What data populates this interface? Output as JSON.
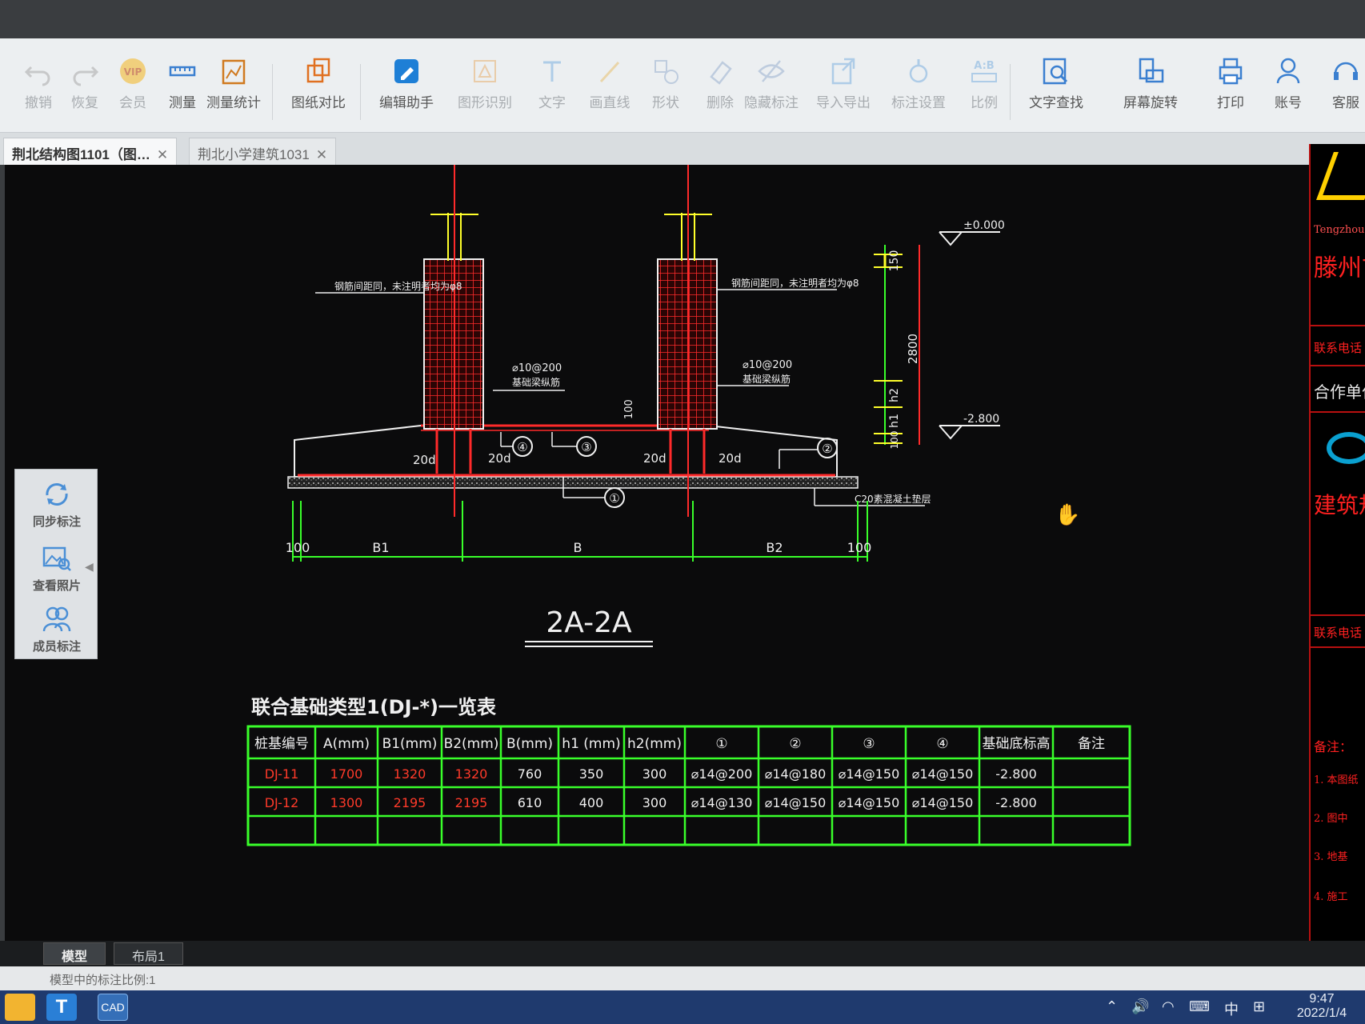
{
  "toolbar": {
    "items": [
      {
        "label": "撤销",
        "icon": "undo-icon",
        "enabled": false
      },
      {
        "label": "恢复",
        "icon": "redo-icon",
        "enabled": false
      },
      {
        "label": "会员",
        "icon": "vip-icon",
        "enabled": false
      },
      {
        "label": "测量",
        "icon": "ruler-icon",
        "enabled": true
      },
      {
        "label": "测量统计",
        "icon": "measure-stats-icon",
        "enabled": true
      },
      {
        "label": "图纸对比",
        "icon": "compare-icon",
        "enabled": true
      },
      {
        "label": "编辑助手",
        "icon": "edit-assistant-icon",
        "enabled": true
      },
      {
        "label": "图形识别",
        "icon": "shape-recognize-icon",
        "enabled": false
      },
      {
        "label": "文字",
        "icon": "text-icon",
        "enabled": false
      },
      {
        "label": "画直线",
        "icon": "line-icon",
        "enabled": false
      },
      {
        "label": "形状",
        "icon": "shape-icon",
        "enabled": false
      },
      {
        "label": "删除",
        "icon": "eraser-icon",
        "enabled": false
      },
      {
        "label": "隐藏标注",
        "icon": "hide-icon",
        "enabled": false
      },
      {
        "label": "导入导出",
        "icon": "import-export-icon",
        "enabled": false
      },
      {
        "label": "标注设置",
        "icon": "annotation-settings-icon",
        "enabled": false
      },
      {
        "label": "比例",
        "icon": "scale-icon",
        "enabled": false
      },
      {
        "label": "文字查找",
        "icon": "text-search-icon",
        "enabled": true
      },
      {
        "label": "屏幕旋转",
        "icon": "rotate-screen-icon",
        "enabled": true
      },
      {
        "label": "打印",
        "icon": "print-icon",
        "enabled": true
      },
      {
        "label": "账号",
        "icon": "account-icon",
        "enabled": true
      },
      {
        "label": "客服",
        "icon": "support-icon",
        "enabled": true
      }
    ]
  },
  "tabs": [
    {
      "label": "荆北结构图1101（图…",
      "active": true
    },
    {
      "label": "荆北小学建筑1031",
      "active": false
    }
  ],
  "side_panel": {
    "items": [
      {
        "label": "同步标注",
        "icon": "sync-icon"
      },
      {
        "label": "查看照片",
        "icon": "photo-icon"
      },
      {
        "label": "成员标注",
        "icon": "members-icon"
      }
    ]
  },
  "drawing": {
    "section_title": "2A-2A",
    "elevation_top": "±0.000",
    "elevation_bottom": "-2.800",
    "dim_top": "150",
    "dim_height": "2800",
    "dim_h2": "h2",
    "dim_h1": "h1",
    "dim_100": "100",
    "bottom_dims": [
      "100",
      "B1",
      "B",
      "B2",
      "100"
    ],
    "anchor_labels": [
      "20d",
      "20d",
      "20d",
      "20d"
    ],
    "stirrup_text": "⌀10@200",
    "stirrup_note": "基础梁纵筋",
    "column_note": "钢筋间距同，未注明者均为φ8",
    "bottom_note": "C20素混凝土垫层",
    "callouts": [
      "①",
      "②",
      "③",
      "④"
    ]
  },
  "table": {
    "title": "联合基础类型1(DJ-*)一览表",
    "headers": [
      "桩基编号",
      "A(mm)",
      "B1(mm)",
      "B2(mm)",
      "B(mm)",
      "h1 (mm)",
      "h2(mm)",
      "①",
      "②",
      "③",
      "④",
      "基础底标高",
      "备注"
    ],
    "rows": [
      [
        "DJ-11",
        "1700",
        "1320",
        "1320",
        "760",
        "350",
        "300",
        "⌀14@200",
        "⌀14@180",
        "⌀14@150",
        "⌀14@150",
        "-2.800",
        ""
      ],
      [
        "DJ-12",
        "1300",
        "2195",
        "2195",
        "610",
        "400",
        "300",
        "⌀14@130",
        "⌀14@150",
        "⌀14@150",
        "⌀14@150",
        "-2.800",
        ""
      ],
      [
        "",
        "",
        "",
        "",
        "",
        "",
        "",
        "",
        "",
        "",
        "",
        "",
        ""
      ]
    ]
  },
  "title_block": {
    "logo_text": "Tengzhou",
    "company": "滕州市",
    "contact1": "联系电话",
    "partner": "合作单位",
    "design": "建筑规划",
    "contact2": "联系电话",
    "notes": "备注：",
    "note_lines": [
      "1. 本图纸",
      "2. 图中",
      "3. 地基",
      "4. 施工"
    ]
  },
  "layout_tabs": [
    {
      "label": "模型",
      "active": true
    },
    {
      "label": "布局1",
      "active": false
    }
  ],
  "status_text": "模型中的标注比例:1",
  "taskbar": {
    "time": "9:47",
    "date": "2022/1/4",
    "ime": "中"
  },
  "colors": {
    "cad_bg": "#0b0b0c",
    "red": "#ff2a2a",
    "green": "#39ff2a",
    "yellow": "#ffff2a",
    "white": "#f0f0f0",
    "hatch": "#9a9a9a"
  }
}
